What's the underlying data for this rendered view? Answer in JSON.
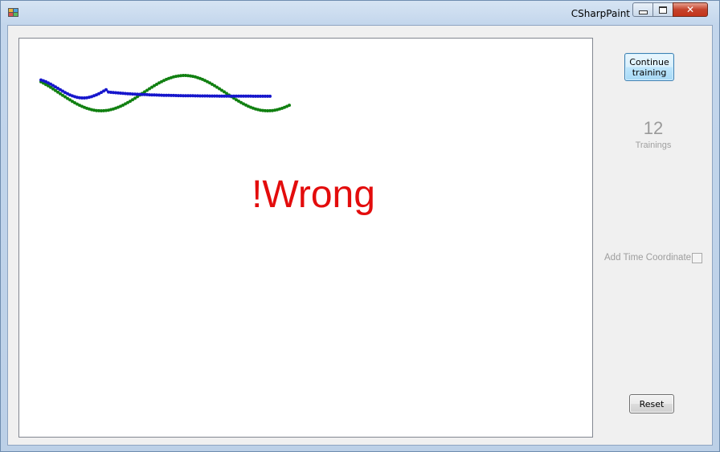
{
  "window": {
    "title": "CSharpPaint",
    "close_glyph": "✕"
  },
  "canvas": {
    "result_text": "!Wrong",
    "result_color": "#e30c0c",
    "strokes": [
      {
        "name": "reference-stroke",
        "color": "#118011"
      },
      {
        "name": "user-stroke",
        "color": "#1616cc"
      }
    ]
  },
  "sidebar": {
    "continue_button_label": "Continue\ntraining",
    "training_count": "12",
    "trainings_label": "Trainings",
    "time_coordinate_label": "Add Time Coordinate",
    "time_coordinate_checked": false,
    "reset_button_label": "Reset"
  },
  "icons": {
    "app": "app-icon",
    "minimize": "minimize-icon",
    "maximize": "maximize-icon",
    "close": "close-icon"
  }
}
